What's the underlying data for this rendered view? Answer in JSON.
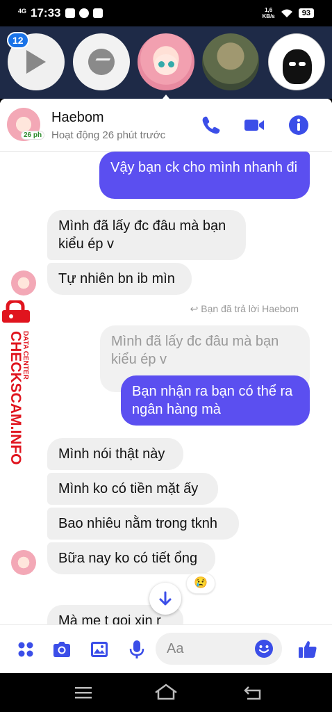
{
  "status_bar": {
    "network": "4G",
    "time": "17:33",
    "speed_value": "1,6",
    "speed_unit": "KB/s",
    "battery": "93"
  },
  "chat_heads": {
    "badge_count": "12"
  },
  "header": {
    "name": "Haebom",
    "active_short": "26 ph",
    "status": "Hoạt động 26 phút trước"
  },
  "messages": [
    {
      "dir": "out",
      "text": "Vậy bạn ck cho mình nhanh đi"
    },
    {
      "dir": "in",
      "text": "Mình đã lấy đc đâu mà bạn kiểu ép v"
    },
    {
      "dir": "in",
      "text": "Tự nhiên bn ib mìn"
    },
    {
      "dir": "note",
      "text": "Bạn đã trả lời Haebom"
    },
    {
      "dir": "quoted",
      "text": "Mình đã lấy đc đâu mà bạn kiểu ép v"
    },
    {
      "dir": "out",
      "text": "Bạn nhận ra bạn có thể ra ngân hàng mà"
    },
    {
      "dir": "in",
      "text": "Mình nói thật này"
    },
    {
      "dir": "in",
      "text": "Mình ko có tiền mặt ấy"
    },
    {
      "dir": "in",
      "text": "Bao nhiêu nằm trong tknh"
    },
    {
      "dir": "in",
      "text": "Bữa nay ko có tiết ổng"
    },
    {
      "dir": "in",
      "text": "Mà mẹ t gọi xin r"
    }
  ],
  "reaction": "😢",
  "watermark": {
    "brand": "CHECKSCAM.INFO",
    "sub": "DATA CENTER"
  },
  "composer": {
    "placeholder": "Aa"
  },
  "colors": {
    "accent": "#5b4ff0",
    "icon_blue": "#3b4ee8",
    "watermark_red": "#e0141e"
  }
}
